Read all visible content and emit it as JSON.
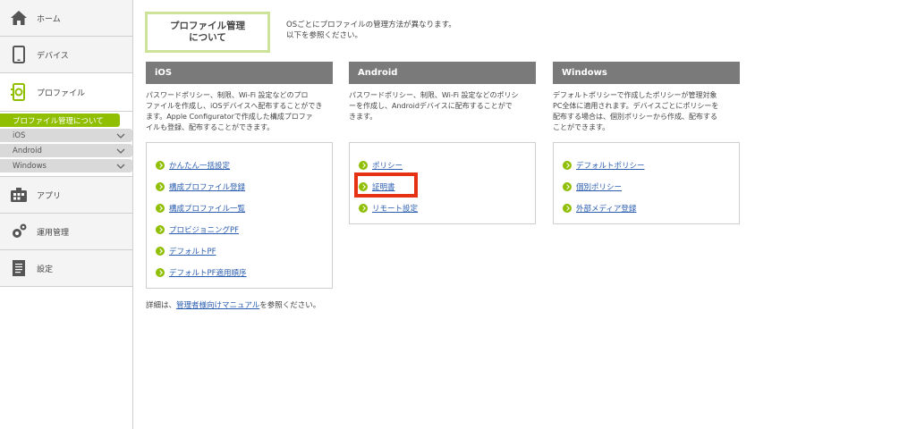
{
  "sidebar": {
    "items": [
      {
        "label": "ホーム",
        "icon": "home-icon"
      },
      {
        "label": "デバイス",
        "icon": "device-icon"
      },
      {
        "label": "プロファイル",
        "icon": "profile-icon"
      },
      {
        "label": "アプリ",
        "icon": "app-icon"
      },
      {
        "label": "運用管理",
        "icon": "gear-icon"
      },
      {
        "label": "設定",
        "icon": "document-icon"
      }
    ],
    "submenu": {
      "active": "プロファイル管理について",
      "items": [
        "iOS",
        "Android",
        "Windows"
      ]
    }
  },
  "main": {
    "title": "プロファイル管理\nについて",
    "intro": "OSごとにプロファイルの管理方法が異なります。\n以下を参照ください。",
    "columns": [
      {
        "header": "iOS",
        "desc": "パスワードポリシー、制限、Wi-Fi 設定などのプロ\nファイルを作成し、iOSデバイスへ配布することができ\nます。Apple Configuratorで作成した構成プロファ\nイルも登録、配布することができます。",
        "links": [
          "かんたん一括設定",
          "構成プロファイル登録",
          "構成プロファイル一覧",
          "プロビジョニングPF",
          "デフォルトPF",
          "デフォルトPF適用順序"
        ]
      },
      {
        "header": "Android",
        "desc": "パスワードポリシー、制限、Wi-Fi 設定などのポリシ\nーを作成し、Androidデバイスに配布することがで\nきます。",
        "links": [
          "ポリシー",
          "証明書",
          "リモート設定"
        ]
      },
      {
        "header": "Windows",
        "desc": "デフォルトポリシーで作成したポリシーが管理対象\nPC全体に適用されます。デバイスごとにポリシーを\n配布する場合は、個別ポリシーから作成、配布する\nことができます。",
        "links": [
          "デフォルトポリシー",
          "個別ポリシー",
          "外部メディア登録"
        ]
      }
    ],
    "footer": {
      "prefix": "詳細は、",
      "link": "管理者様向けマニュアル",
      "suffix": "を参照ください。"
    }
  },
  "colors": {
    "accent": "#8fbf00",
    "header": "#7a7a7a",
    "highlight": "#e53212",
    "link": "#2a5db0"
  }
}
